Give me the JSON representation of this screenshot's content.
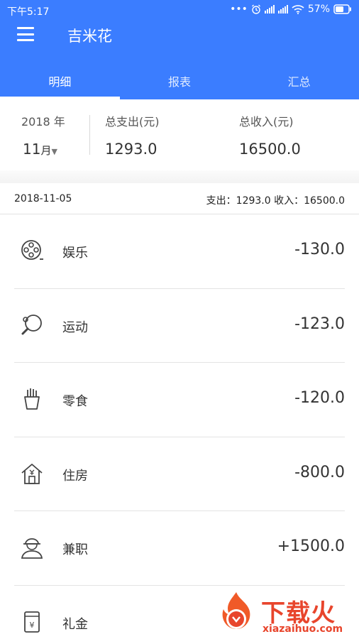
{
  "status_bar": {
    "time": "下午5:17",
    "battery": "57%"
  },
  "app": {
    "title": "吉米花"
  },
  "tabs": [
    {
      "label": "明细",
      "active": true
    },
    {
      "label": "报表",
      "active": false
    },
    {
      "label": "汇总",
      "active": false
    }
  ],
  "summary": {
    "year": "2018 年",
    "month": "11",
    "month_unit": "月",
    "expense_label": "总支出(元)",
    "expense_value": "1293.0",
    "income_label": "总收入(元)",
    "income_value": "16500.0"
  },
  "day": {
    "date": "2018-11-05",
    "totals": "支出：1293.0 收入：16500.0"
  },
  "records": [
    {
      "category": "娱乐",
      "amount": "-130.0",
      "icon": "film-reel-icon"
    },
    {
      "category": "运动",
      "amount": "-123.0",
      "icon": "ping-pong-icon"
    },
    {
      "category": "零食",
      "amount": "-120.0",
      "icon": "fries-icon"
    },
    {
      "category": "住房",
      "amount": "-800.0",
      "icon": "house-icon"
    },
    {
      "category": "兼职",
      "amount": "+1500.0",
      "icon": "worker-icon"
    },
    {
      "category": "礼金",
      "amount": "",
      "icon": "red-envelope-icon"
    }
  ],
  "watermark": {
    "brand": "下载火",
    "domain": "xiazaihuo.com"
  },
  "colors": {
    "primary": "#3b7dff",
    "text": "#333333",
    "watermark": "#e8452c"
  }
}
